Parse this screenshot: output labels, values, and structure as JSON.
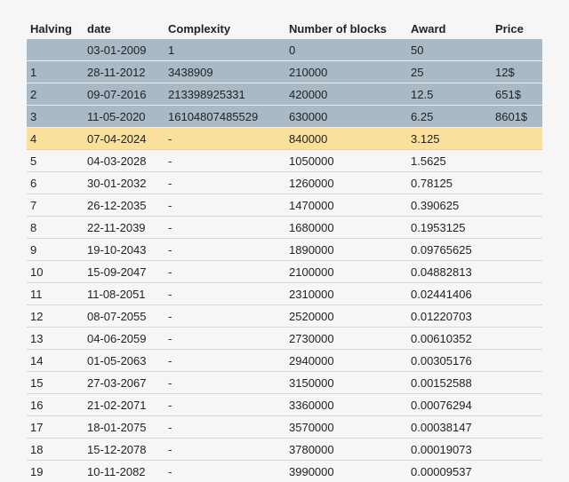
{
  "table": {
    "headers": [
      "Halving",
      "date",
      "Complexity",
      "Number of blocks",
      "Award",
      "Price"
    ],
    "rows": [
      {
        "status": "past",
        "cells": [
          "",
          "03-01-2009",
          "1",
          "0",
          "50",
          ""
        ]
      },
      {
        "status": "past",
        "cells": [
          "1",
          "28-11-2012",
          "3438909",
          "210000",
          "25",
          "12$"
        ]
      },
      {
        "status": "past",
        "cells": [
          "2",
          "09-07-2016",
          "213398925331",
          "420000",
          "12.5",
          "651$"
        ]
      },
      {
        "status": "past",
        "cells": [
          "3",
          "11-05-2020",
          "16104807485529",
          "630000",
          "6.25",
          "8601$"
        ]
      },
      {
        "status": "current",
        "cells": [
          "4",
          "07-04-2024",
          "-",
          "840000",
          "3.125",
          ""
        ]
      },
      {
        "status": "future",
        "cells": [
          "5",
          "04-03-2028",
          "-",
          "1050000",
          "1.5625",
          ""
        ]
      },
      {
        "status": "future",
        "cells": [
          "6",
          "30-01-2032",
          "-",
          "1260000",
          "0.78125",
          ""
        ]
      },
      {
        "status": "future",
        "cells": [
          "7",
          "26-12-2035",
          "-",
          "1470000",
          "0.390625",
          ""
        ]
      },
      {
        "status": "future",
        "cells": [
          "8",
          "22-11-2039",
          "-",
          "1680000",
          "0.1953125",
          ""
        ]
      },
      {
        "status": "future",
        "cells": [
          "9",
          "19-10-2043",
          "-",
          "1890000",
          "0.09765625",
          ""
        ]
      },
      {
        "status": "future",
        "cells": [
          "10",
          "15-09-2047",
          "-",
          "2100000",
          "0.04882813",
          ""
        ]
      },
      {
        "status": "future",
        "cells": [
          "11",
          "11-08-2051",
          "-",
          "2310000",
          "0.02441406",
          ""
        ]
      },
      {
        "status": "future",
        "cells": [
          "12",
          "08-07-2055",
          "-",
          "2520000",
          "0.01220703",
          ""
        ]
      },
      {
        "status": "future",
        "cells": [
          "13",
          "04-06-2059",
          "-",
          "2730000",
          "0.00610352",
          ""
        ]
      },
      {
        "status": "future",
        "cells": [
          "14",
          "01-05-2063",
          "-",
          "2940000",
          "0.00305176",
          ""
        ]
      },
      {
        "status": "future",
        "cells": [
          "15",
          "27-03-2067",
          "-",
          "3150000",
          "0.00152588",
          ""
        ]
      },
      {
        "status": "future",
        "cells": [
          "16",
          "21-02-2071",
          "-",
          "3360000",
          "0.00076294",
          ""
        ]
      },
      {
        "status": "future",
        "cells": [
          "17",
          "18-01-2075",
          "-",
          "3570000",
          "0.00038147",
          ""
        ]
      },
      {
        "status": "future",
        "cells": [
          "18",
          "15-12-2078",
          "-",
          "3780000",
          "0.00019073",
          ""
        ]
      },
      {
        "status": "future",
        "cells": [
          "19",
          "10-11-2082",
          "-",
          "3990000",
          "0.00009537",
          ""
        ]
      }
    ]
  },
  "colors": {
    "past_row": "#a9b9c6",
    "current_row": "#fbe09b",
    "background": "#f6f6f6"
  }
}
